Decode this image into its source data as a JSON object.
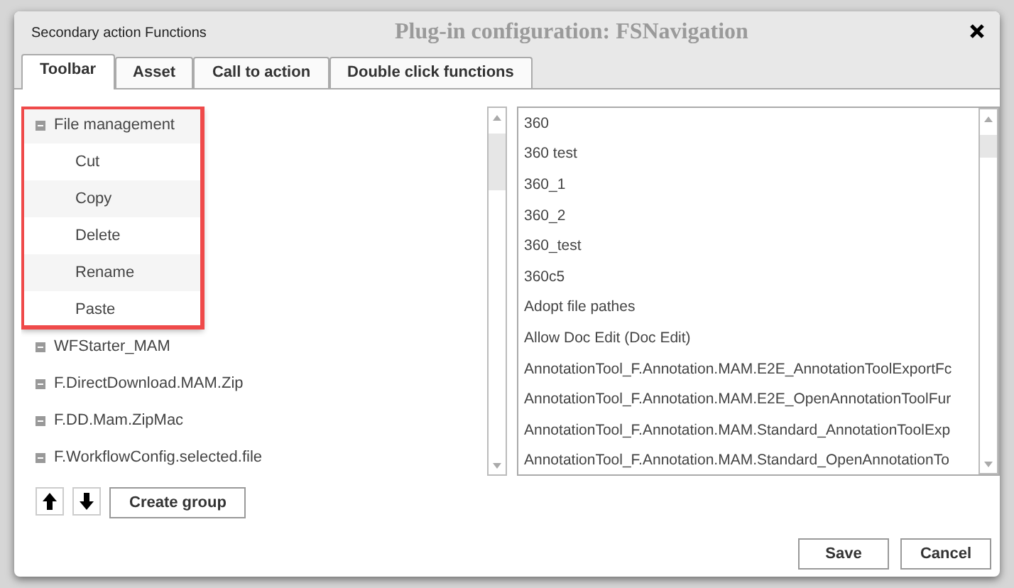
{
  "dialog": {
    "title": "Secondary action Functions",
    "background_title": "Plug-in configuration: FSNavigation"
  },
  "tabs": [
    {
      "label": "Toolbar",
      "selected": true
    },
    {
      "label": "Asset",
      "selected": false
    },
    {
      "label": "Call to action",
      "selected": false
    },
    {
      "label": "Double click functions",
      "selected": false
    }
  ],
  "toolbar_tree": [
    {
      "label": "File management",
      "expanded": true,
      "highlighted": true,
      "children": [
        {
          "label": "Cut"
        },
        {
          "label": "Copy"
        },
        {
          "label": "Delete"
        },
        {
          "label": "Rename"
        },
        {
          "label": "Paste"
        }
      ]
    },
    {
      "label": "WFStarter_MAM",
      "expanded": true,
      "highlighted": false
    },
    {
      "label": "F.DirectDownload.MAM.Zip",
      "expanded": true,
      "highlighted": false
    },
    {
      "label": "F.DD.Mam.ZipMac",
      "expanded": true,
      "highlighted": false
    },
    {
      "label": "F.WorkflowConfig.selected.file",
      "expanded": true,
      "highlighted": false
    }
  ],
  "available_functions": [
    "360",
    "360 test",
    "360_1",
    "360_2",
    "360_test",
    "360c5",
    "Adopt file pathes",
    "Allow Doc Edit (Doc Edit)",
    "AnnotationTool_F.Annotation.MAM.E2E_AnnotationToolExportFc",
    "AnnotationTool_F.Annotation.MAM.E2E_OpenAnnotationToolFur",
    "AnnotationTool_F.Annotation.MAM.Standard_AnnotationToolExp",
    "AnnotationTool_F.Annotation.MAM.Standard_OpenAnnotationTo"
  ],
  "create_group_button": "Create group",
  "buttons": [
    "Save",
    "Cancel"
  ]
}
